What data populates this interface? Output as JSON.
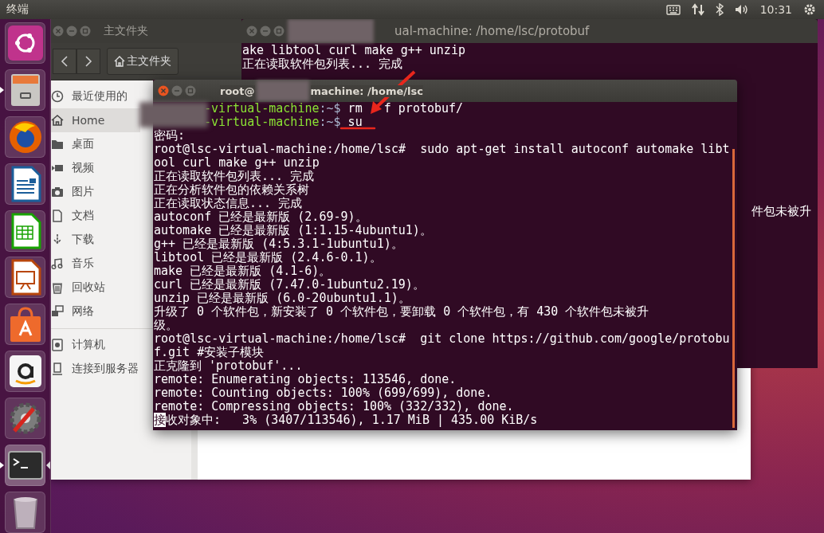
{
  "top_panel": {
    "app_title": "终端",
    "clock": "10:31"
  },
  "launcher": {
    "items": [
      {
        "kind": "dash",
        "running": false,
        "focused": false
      },
      {
        "kind": "files",
        "running": true,
        "focused": false
      },
      {
        "kind": "browser",
        "running": false,
        "focused": false
      },
      {
        "kind": "writer",
        "running": false,
        "focused": false
      },
      {
        "kind": "calc",
        "running": false,
        "focused": false
      },
      {
        "kind": "impress",
        "running": false,
        "focused": false
      },
      {
        "kind": "store",
        "running": false,
        "focused": false
      },
      {
        "kind": "amazon",
        "running": false,
        "focused": false
      },
      {
        "kind": "settings",
        "running": false,
        "focused": false
      },
      {
        "kind": "terminal",
        "running": true,
        "focused": true
      },
      {
        "kind": "trash",
        "running": false,
        "focused": false
      }
    ]
  },
  "file_manager": {
    "title": "主文件夹",
    "path_button": "主文件夹",
    "sections": [
      {
        "items": [
          {
            "kind": "recent",
            "label": "最近使用的",
            "selected": false
          },
          {
            "kind": "home",
            "label": "Home",
            "selected": true
          },
          {
            "kind": "folder",
            "label": "桌面",
            "selected": false
          },
          {
            "kind": "video",
            "label": "视频",
            "selected": false
          },
          {
            "kind": "camera",
            "label": "图片",
            "selected": false
          },
          {
            "kind": "document",
            "label": "文档",
            "selected": false
          },
          {
            "kind": "download",
            "label": "下载",
            "selected": false
          },
          {
            "kind": "music",
            "label": "音乐",
            "selected": false
          },
          {
            "kind": "trash",
            "label": "回收站",
            "selected": false
          },
          {
            "kind": "network",
            "label": "网络",
            "selected": false
          }
        ]
      },
      {
        "items": [
          {
            "kind": "computer",
            "label": "计算机",
            "selected": false
          },
          {
            "kind": "server",
            "label": "连接到服务器",
            "selected": false
          }
        ]
      }
    ]
  },
  "back_terminal": {
    "title": "ual-machine: /home/lsc/protobuf",
    "lines": [
      "ake libtool curl make g++ unzip",
      "正在读取软件包列表... 完成"
    ],
    "fragment": "件包未被升"
  },
  "front_terminal": {
    "title_start": "root@",
    "title_end": "machine: /home/lsc",
    "lines": [
      {
        "kind": "prompt",
        "user": "-virtual-machine",
        "path": ":~$",
        "command": " rm",
        "command_tail": "f protobuf/"
      },
      {
        "kind": "prompt",
        "user": "-virtual-machine",
        "path": ":~$",
        "command": " su"
      },
      {
        "kind": "output",
        "text": "密码:"
      },
      {
        "kind": "output",
        "text": "root@lsc-virtual-machine:/home/lsc#  sudo apt-get install autoconf automake libt"
      },
      {
        "kind": "output",
        "text": "ool curl make g++ unzip"
      },
      {
        "kind": "output",
        "text": "正在读取软件包列表... 完成"
      },
      {
        "kind": "output",
        "text": "正在分析软件包的依赖关系树"
      },
      {
        "kind": "output",
        "text": "正在读取状态信息... 完成"
      },
      {
        "kind": "output",
        "text": "autoconf 已经是最新版 (2.69-9)。"
      },
      {
        "kind": "output",
        "text": "automake 已经是最新版 (1:1.15-4ubuntu1)。"
      },
      {
        "kind": "output",
        "text": "g++ 已经是最新版 (4:5.3.1-1ubuntu1)。"
      },
      {
        "kind": "output",
        "text": "libtool 已经是最新版 (2.4.6-0.1)。"
      },
      {
        "kind": "output",
        "text": "make 已经是最新版 (4.1-6)。"
      },
      {
        "kind": "output",
        "text": "curl 已经是最新版 (7.47.0-1ubuntu2.19)。"
      },
      {
        "kind": "output",
        "text": "unzip 已经是最新版 (6.0-20ubuntu1.1)。"
      },
      {
        "kind": "output",
        "text": "升级了 0 个软件包，新安装了 0 个软件包，要卸载 0 个软件包，有 430 个软件包未被升"
      },
      {
        "kind": "output",
        "text": "级。"
      },
      {
        "kind": "output",
        "text": "root@lsc-virtual-machine:/home/lsc#  git clone https://github.com/google/protobu"
      },
      {
        "kind": "output",
        "text": "f.git #安装子模块"
      },
      {
        "kind": "output",
        "text": "正克隆到 'protobuf'..."
      },
      {
        "kind": "output",
        "text": "remote: Enumerating objects: 113546, done."
      },
      {
        "kind": "output",
        "text": "remote: Counting objects: 100% (699/699), done."
      },
      {
        "kind": "output",
        "text": "remote: Compressing objects: 100% (332/332), done."
      },
      {
        "kind": "cursor",
        "cursor": "接",
        "text": "收对象中:   3% (3407/113546), 1.17 MiB | 435.00 KiB/s"
      }
    ]
  }
}
